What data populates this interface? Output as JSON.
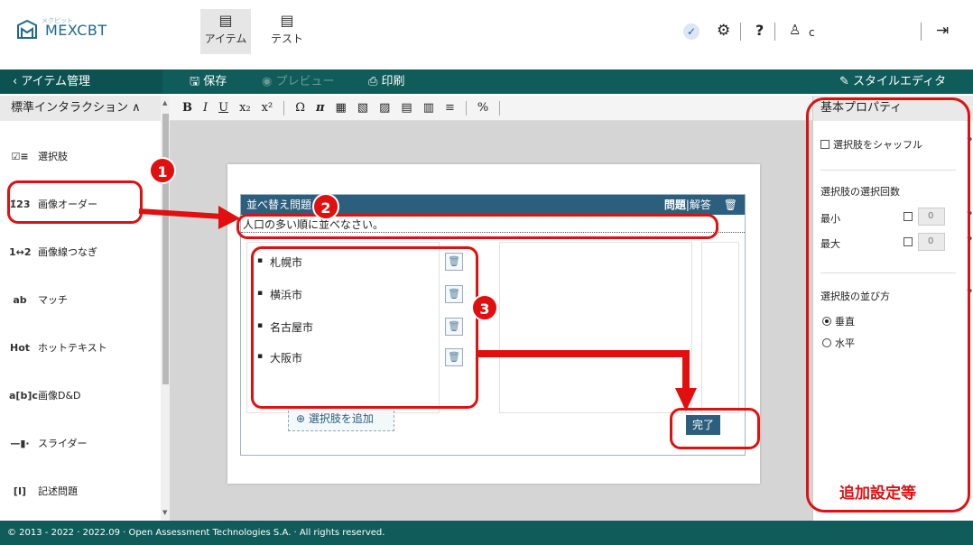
{
  "header": {
    "logo_text": "MEXCBT",
    "logo_sub": "メクビット",
    "tabs": [
      {
        "label": "アイテム",
        "icon": "document-icon"
      },
      {
        "label": "テスト",
        "icon": "document-icon"
      }
    ],
    "help": "?",
    "user": "c"
  },
  "actionbar": {
    "back": "‹ アイテム管理",
    "save": "保存",
    "preview": "プレビュー",
    "print": "印刷",
    "style_editor": "スタイルエディタ"
  },
  "sidebar": {
    "title": "標準インタラクション ∧",
    "items": [
      {
        "icon": "☑≡",
        "label": "選択肢"
      },
      {
        "icon": "1̂23",
        "label": "画像オーダー"
      },
      {
        "icon": "1↔2",
        "label": "画像線つなぎ"
      },
      {
        "icon": "ab",
        "label": "マッチ"
      },
      {
        "icon": "Hot",
        "label": "ホットテキスト"
      },
      {
        "icon": "a[b]c",
        "label": "画像D&D"
      },
      {
        "icon": "—▮·",
        "label": "スライダー"
      },
      {
        "icon": "[I]",
        "label": "記述問題"
      }
    ]
  },
  "toolbar": {
    "buttons": [
      "B",
      "I",
      "U",
      "x₂",
      "x²",
      "Ω",
      "π",
      "▦",
      "▧",
      "▨",
      "▤",
      "▥",
      "≡",
      "%"
    ]
  },
  "question": {
    "head_title": "並べ替え問題",
    "tab_question": "問題",
    "tab_separator": "|",
    "tab_answer": "解答",
    "prompt": "人口の多い順に並べなさい。",
    "choices": [
      "札幌市",
      "横浜市",
      "名古屋市",
      "大阪市"
    ],
    "add_choice": "⊕ 選択肢を追加",
    "done": "完了"
  },
  "rpanel": {
    "title": "基本プロパティ",
    "shuffle": "選択肢をシャッフル",
    "select_count": "選択肢の選択回数",
    "min_label": "最小",
    "max_label": "最大",
    "min_value": "0",
    "max_value": "0",
    "orientation": "選択肢の並び方",
    "vertical": "垂直",
    "horizontal": "水平",
    "help": "?",
    "extra_settings": "追加設定等"
  },
  "annotations": {
    "badge1": "1",
    "badge2": "2",
    "badge3": "3",
    "color": "#e01010"
  },
  "footer": {
    "text": "© 2013 - 2022 · 2022.09 · Open Assessment Technologies S.A. · All rights reserved."
  }
}
